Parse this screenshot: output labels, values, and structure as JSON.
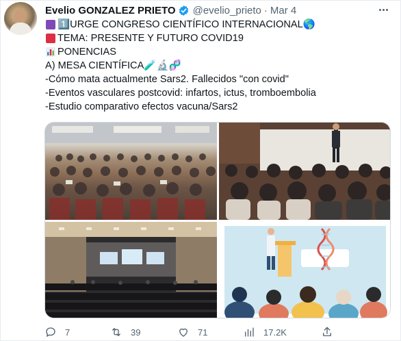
{
  "tweet": {
    "author_name": "Evelio GONZALEZ PRIETO",
    "handle": "@evelio_prieto",
    "separator": "·",
    "date": "Mar 4",
    "lines": [
      "1️⃣URGE CONGRESO CIENTÍFICO INTERNACIONAL🌎",
      "TEMA: PRESENTE Y FUTURO COVID19",
      "PONENCIAS",
      "A) MESA CIENTÍFICA🧪🔬🧬",
      "-Cómo mata actualmente Sars2. Fallecidos \"con covid\"",
      "-Eventos vasculares postcovid: infartos, ictus, tromboembolia",
      "-Estudio comparativo efectos vacuna/Sars2"
    ],
    "line_icons": [
      "purple-square-icon",
      "red-square-icon",
      "bar-chart-icon"
    ],
    "actions": {
      "replies": "7",
      "retweets": "39",
      "likes": "71",
      "views": "17.2K"
    }
  },
  "media": [
    "conference-audience-photo",
    "speaker-on-stage-photo",
    "auditorium-photo",
    "scientific-conference-illustration"
  ],
  "colors": {
    "verified": "#1d9bf0",
    "secondary_text": "#536471",
    "purple_square": "#7f49b6",
    "red_square": "#dd2e44",
    "keycap": "#3b88c3"
  }
}
